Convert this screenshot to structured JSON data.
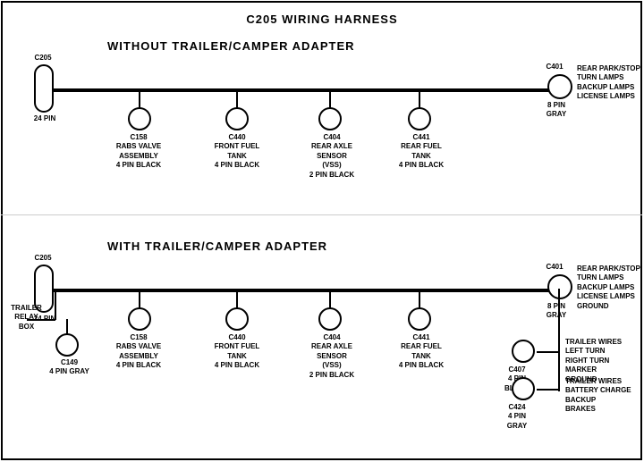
{
  "title": "C205 WIRING HARNESS",
  "sections": {
    "top": {
      "label": "WITHOUT  TRAILER/CAMPER  ADAPTER",
      "connectors": [
        {
          "id": "C205_top",
          "label": "C205",
          "sub": "24 PIN"
        },
        {
          "id": "C158_top",
          "label": "C158",
          "sub": "RABS VALVE\nASSEMBLY\n4 PIN BLACK"
        },
        {
          "id": "C440_top",
          "label": "C440",
          "sub": "FRONT FUEL\nTANK\n4 PIN BLACK"
        },
        {
          "id": "C404_top",
          "label": "C404",
          "sub": "REAR AXLE\nSENSOR\n(VSS)\n2 PIN BLACK"
        },
        {
          "id": "C441_top",
          "label": "C441",
          "sub": "REAR FUEL\nTANK\n4 PIN BLACK"
        },
        {
          "id": "C401_top",
          "label": "C401",
          "sub": "8 PIN\nGRAY"
        }
      ],
      "c401_label": "REAR PARK/STOP\nTURN LAMPS\nBACKUP LAMPS\nLICENSE LAMPS"
    },
    "bottom": {
      "label": "WITH  TRAILER/CAMPER  ADAPTER",
      "connectors": [
        {
          "id": "C205_bot",
          "label": "C205",
          "sub": "24 PIN"
        },
        {
          "id": "C149",
          "label": "C149",
          "sub": "4 PIN GRAY"
        },
        {
          "id": "C158_bot",
          "label": "C158",
          "sub": "RABS VALVE\nASSEMBLY\n4 PIN BLACK"
        },
        {
          "id": "C440_bot",
          "label": "C440",
          "sub": "FRONT FUEL\nTANK\n4 PIN BLACK"
        },
        {
          "id": "C404_bot",
          "label": "C404",
          "sub": "REAR AXLE\nSENSOR\n(VSS)\n2 PIN BLACK"
        },
        {
          "id": "C441_bot",
          "label": "C441",
          "sub": "REAR FUEL\nTANK\n4 PIN BLACK"
        },
        {
          "id": "C401_bot",
          "label": "C401",
          "sub": "8 PIN\nGRAY"
        },
        {
          "id": "C407",
          "label": "C407",
          "sub": "4 PIN\nBLACK"
        },
        {
          "id": "C424",
          "label": "C424",
          "sub": "4 PIN\nGRAY"
        }
      ],
      "trailer_relay": "TRAILER\nRELAY\nBOX",
      "c401_label": "REAR PARK/STOP\nTURN LAMPS\nBACKUP LAMPS\nLICENSE LAMPS\nGROUND",
      "c407_label": "TRAILER WIRES\nLEFT TURN\nRIGHT TURN\nMARKER\nGROUND",
      "c424_label": "TRAILER WIRES\nBATTERY CHARGE\nBACKUP\nBRAKES"
    }
  }
}
